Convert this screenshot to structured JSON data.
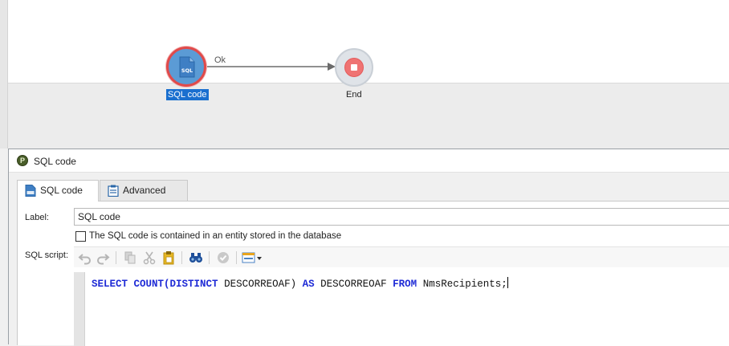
{
  "workflow": {
    "sql_node_label": "SQL code",
    "sql_node_icon_text": "SQL",
    "end_node_label": "End",
    "transition_label": "Ok"
  },
  "dialog": {
    "title": "SQL code",
    "app_icon_letter": "P",
    "tabs": [
      {
        "label": "SQL code",
        "icon": "sql-file-icon",
        "active": true
      },
      {
        "label": "Advanced",
        "icon": "clipboard-icon",
        "active": false
      }
    ],
    "label_caption": "Label:",
    "label_value": "SQL code",
    "checkbox_text": "The SQL code is contained in an entity stored in the database",
    "checkbox_checked": false,
    "script_caption": "SQL script:",
    "toolbar": [
      "undo-icon",
      "redo-icon",
      "copy-icon",
      "cut-icon",
      "paste-icon",
      "find-binoculars-icon",
      "validate-check-icon",
      "insert-field-icon"
    ]
  },
  "sql": {
    "kw_select": "SELECT",
    "kw_count": "COUNT(DISTINCT",
    "field1": "DESCORREOAF)",
    "kw_as": "AS",
    "field2": "DESCORREOAF",
    "kw_from": "FROM",
    "table": "NmsRecipients;"
  },
  "colors": {
    "sql_node": "#5b9bd5",
    "selection": "#1a6fcf",
    "end_stop": "#ef7373",
    "keyword": "#1f2bd6"
  }
}
